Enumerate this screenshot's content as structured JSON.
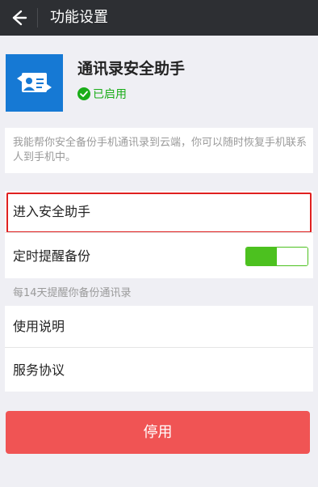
{
  "header": {
    "title": "功能设置",
    "back_icon": "back-arrow-icon"
  },
  "plugin": {
    "name": "通讯录安全助手",
    "status": "已启用",
    "status_color": "#1aad19",
    "icon": "contacts-sync-icon",
    "icon_bg": "#1679d4"
  },
  "description": "我能帮你安全备份手机通讯录到云端，你可以随时恢复手机联系人到手机中。",
  "items": {
    "enter": "进入安全助手",
    "reminder": "定时提醒备份",
    "reminder_on": true,
    "reminder_hint": "每14天提醒你备份通讯录",
    "instructions": "使用说明",
    "agreement": "服务协议"
  },
  "actions": {
    "disable": "停用",
    "disable_color": "#f05454"
  },
  "colors": {
    "accent_green": "#4cc11f",
    "highlight_red": "#e02020",
    "topbar": "#2d2f33"
  }
}
